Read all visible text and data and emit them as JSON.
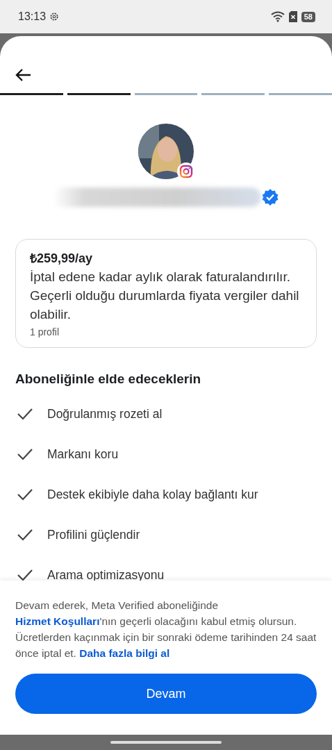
{
  "status_bar": {
    "time": "13:13",
    "battery": "58"
  },
  "steps": [
    {
      "completed": true
    },
    {
      "completed": true
    },
    {
      "completed": false
    },
    {
      "completed": false
    },
    {
      "completed": false
    }
  ],
  "profile": {
    "verified": true
  },
  "plan": {
    "price": "₺259,99/ay",
    "description": "İptal edene kadar aylık olarak faturalandırılır. Geçerli olduğu durumlarda fiyata vergiler dahil olabilir.",
    "profiles": "1 profil"
  },
  "benefits_title": "Aboneliğinle elde edeceklerin",
  "benefits": [
    {
      "text": "Doğrulanmış rozeti al"
    },
    {
      "text": "Markanı koru"
    },
    {
      "text": "Destek ekibiyle daha kolay bağlantı kur"
    },
    {
      "text": "Profilini güçlendir"
    },
    {
      "text": "Arama optimizasyonu"
    }
  ],
  "legal": [
    {
      "kind": "text",
      "text": "Devam ederek, Meta Verified aboneliğinde "
    },
    {
      "kind": "link",
      "text": "Hizmet Koşulları"
    },
    {
      "kind": "text",
      "text": "'nın geçerli olacağını kabul etmiş olursun. Ücretlerden kaçınmak için bir sonraki ödeme tarihinden 24 saat önce iptal et. "
    },
    {
      "kind": "link",
      "text": "Daha fazla bilgi al"
    }
  ],
  "continue_button": "Devam"
}
